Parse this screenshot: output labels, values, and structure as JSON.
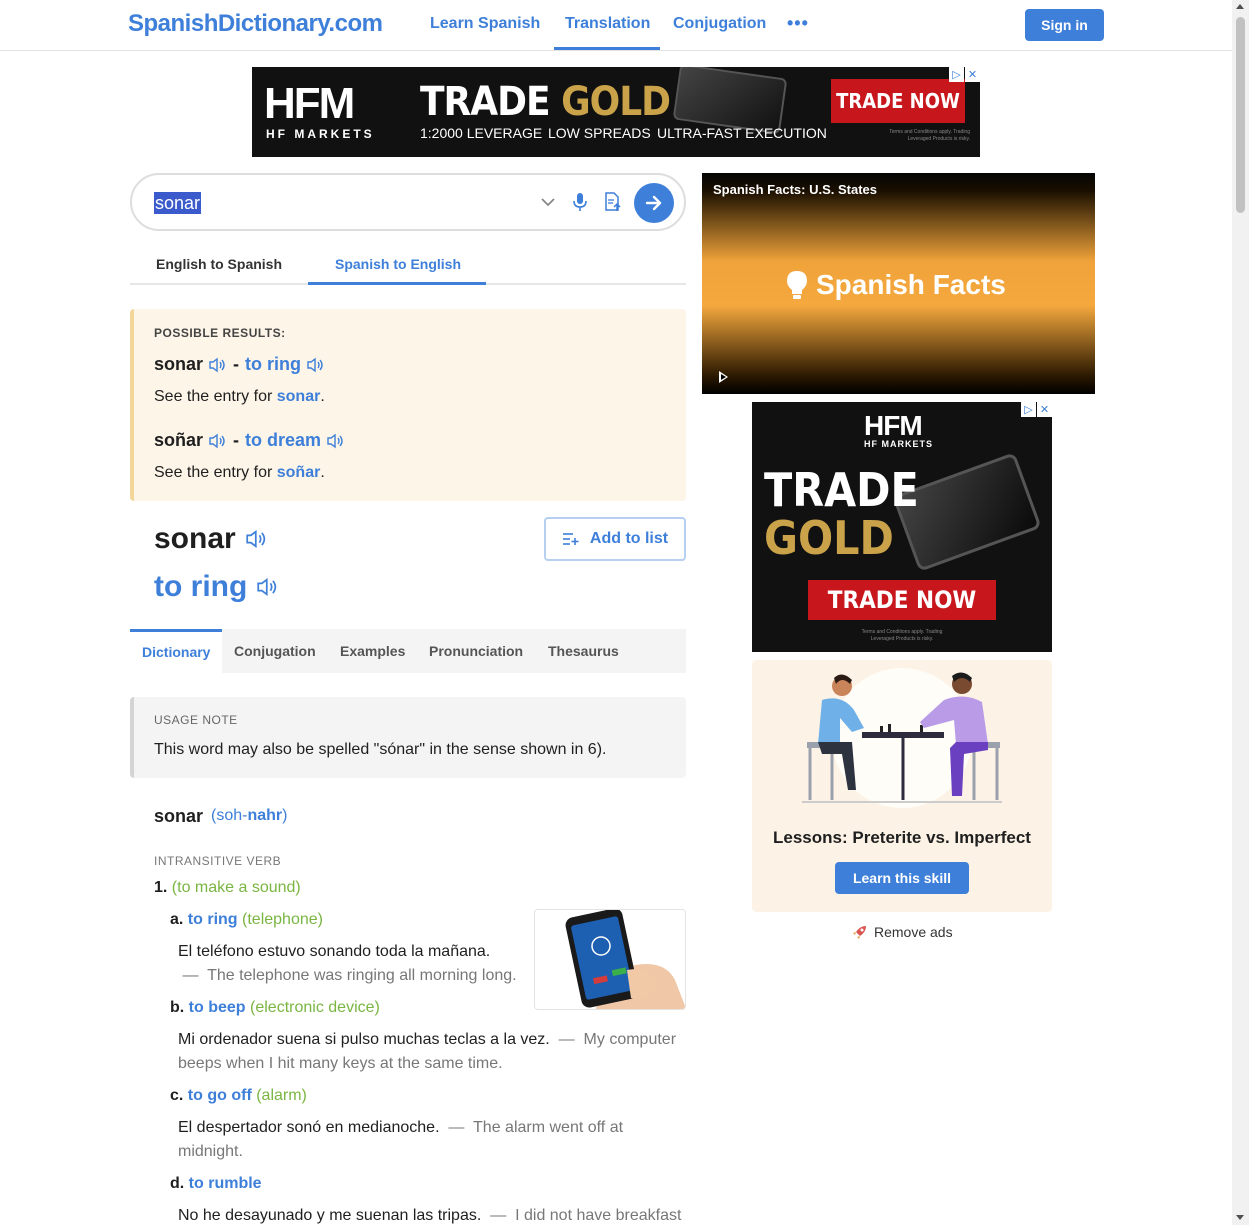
{
  "header": {
    "logo": "SpanishDictionary.com",
    "nav": [
      "Learn Spanish",
      "Translation",
      "Conjugation"
    ],
    "more": "•••",
    "sign_in": "Sign in"
  },
  "ad_top": {
    "brand": "HFM",
    "brand_sub": "HF MARKETS",
    "headline_1": "TRADE",
    "headline_2": "GOLD",
    "features": [
      "1:2000 LEVERAGE",
      "LOW SPREADS",
      "ULTRA-FAST EXECUTION"
    ],
    "cta": "TRADE NOW",
    "terms": "Terms and Conditions apply. Trading Leveraged Products is risky."
  },
  "search": {
    "value": "sonar"
  },
  "direction_tabs": [
    "English to Spanish",
    "Spanish to English"
  ],
  "possible_results": {
    "label": "POSSIBLE RESULTS:",
    "items": [
      {
        "word": "sonar",
        "sep": "-",
        "translation": "to ring",
        "see_prefix": "See the entry for",
        "see_word": "sonar",
        "see_suffix": "."
      },
      {
        "word": "soñar",
        "sep": "-",
        "translation": "to dream",
        "see_prefix": "See the entry for",
        "see_word": "soñar",
        "see_suffix": "."
      }
    ]
  },
  "headword": {
    "word": "sonar",
    "translation": "to ring",
    "add_to_list": "Add to list"
  },
  "content_tabs": [
    "Dictionary",
    "Conjugation",
    "Examples",
    "Pronunciation",
    "Thesaurus"
  ],
  "usage_note": {
    "label": "USAGE NOTE",
    "text": "This word may also be spelled \"sónar\" in the sense shown in 6)."
  },
  "entry": {
    "word": "sonar",
    "pron_open": "(soh-",
    "pron_stress": "nahr",
    "pron_close": ")",
    "pos": "INTRANSITIVE VERB",
    "sense_num": "1.",
    "sense_context": "(to make a sound)",
    "subsenses": [
      {
        "letter": "a.",
        "translation": "to ring",
        "context": "(telephone)",
        "es": "El teléfono estuvo sonando toda la mañana.",
        "sep": "—",
        "en": "The telephone was ringing all morning long."
      },
      {
        "letter": "b.",
        "translation": "to beep",
        "context": "(electronic device)",
        "es": "Mi ordenador suena si pulso muchas teclas a la vez.",
        "sep": "—",
        "en": "My computer beeps when I hit many keys at the same time."
      },
      {
        "letter": "c.",
        "translation": "to go off",
        "context": "(alarm)",
        "es": "El despertador sonó en medianoche.",
        "sep": "—",
        "en": "The alarm went off at midnight."
      },
      {
        "letter": "d.",
        "translation": "to rumble",
        "context": "",
        "es": "No he desayunado y me suenan las tripas.",
        "sep": "—",
        "en": "I did not have breakfast"
      }
    ]
  },
  "video": {
    "title": "Spanish Facts: U.S. States",
    "brand": "Spanish Facts"
  },
  "ad_side": {
    "brand": "HFM",
    "brand_sub": "HF MARKETS",
    "headline_1": "TRADE",
    "headline_2": "GOLD",
    "cta": "TRADE NOW",
    "terms": "Terms and Conditions apply. Trading Leveraged Products is risky."
  },
  "lesson": {
    "title": "Lessons: Preterite vs. Imperfect",
    "cta": "Learn this skill"
  },
  "remove_ads": "Remove ads",
  "colors": {
    "accent": "#3d7fd9",
    "context_green": "#7ab541",
    "ad_red": "#c8161d",
    "gold": "#c9a24a"
  }
}
